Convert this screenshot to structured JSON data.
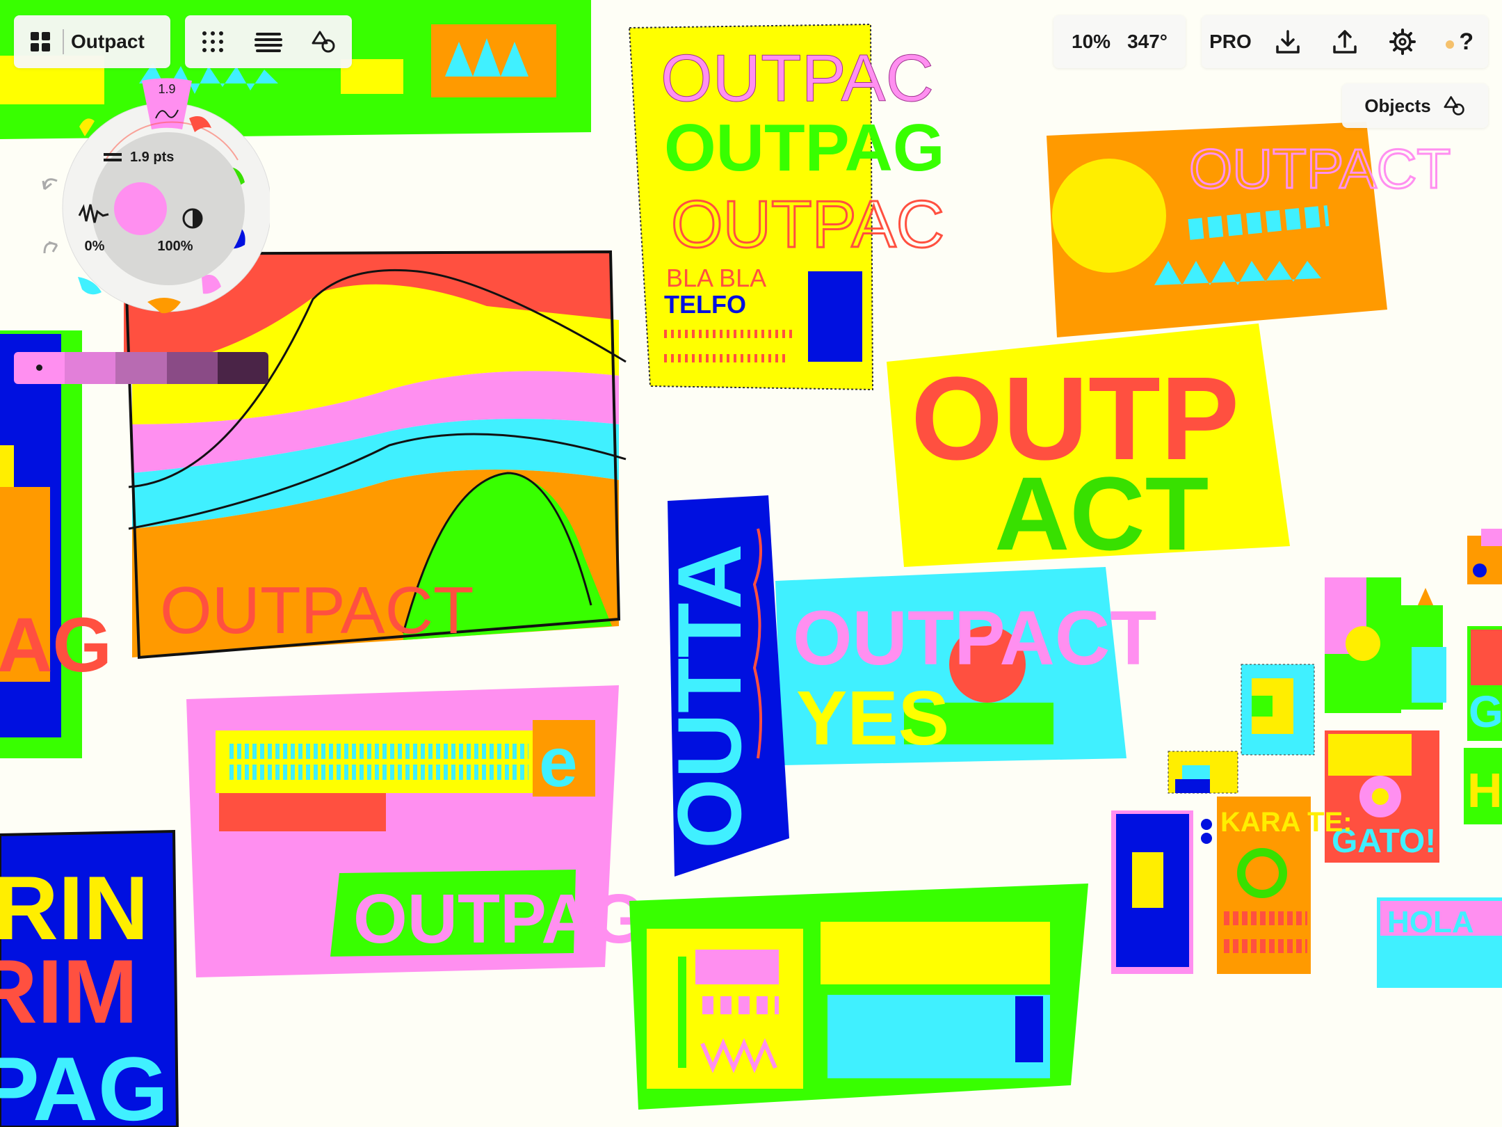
{
  "toolbar_left": {
    "gallery_icon": "grid-2x2-icon",
    "document_title": "Outpact",
    "grid_icon": "dot-grid-icon",
    "layers_icon": "layers-icon",
    "objects_icon": "shapes-icon"
  },
  "toolbar_right": {
    "zoom": "10%",
    "rotation": "347°",
    "pro_label": "PRO",
    "import_icon": "download-icon",
    "export_icon": "share-upload-icon",
    "settings_icon": "gear-icon",
    "help_label": "?",
    "status_dot_color": "#f5c16c"
  },
  "objects_panel": {
    "label": "Objects",
    "icon": "shapes-icon"
  },
  "tool_wheel": {
    "active_tool_size": "1.9",
    "stroke_weight_label": "1.9 pts",
    "smoothing_value": "0%",
    "opacity_value": "100%",
    "current_color": "#ff8ff0",
    "undo_icon": "undo-icon",
    "redo_icon": "redo-icon",
    "smoothing_icon": "squiggle-icon",
    "opacity_icon": "half-circle-icon",
    "tools": [
      {
        "name": "fineliner",
        "color": "#ff8ff0"
      },
      {
        "name": "brush-red",
        "color": "#ff5040"
      },
      {
        "name": "marker-green",
        "color": "#38e000"
      },
      {
        "name": "marker-blue",
        "color": "#0010e0"
      },
      {
        "name": "brush-pink",
        "color": "#ff8ff0"
      },
      {
        "name": "marker-orange",
        "color": "#ff9a00"
      },
      {
        "name": "marker-cyan",
        "color": "#40f0ff"
      },
      {
        "name": "marker-yellow",
        "color": "#ffee00"
      }
    ]
  },
  "palette": {
    "swatches": [
      "#ff8ff0",
      "#e27fd9",
      "#b86bb2",
      "#8a4b86",
      "#4a2447"
    ],
    "selected_index": 0
  },
  "canvas_text": {
    "outpac_1": "OUTPAC",
    "outpag_1": "OUTPAG",
    "outpac_2": "OUTPAC",
    "bla_bla": "BLA BLA",
    "telefo": "TELFO",
    "outpact_orange": "OUTPACT",
    "outpact_poster": "OUTPACT",
    "outp": "OUTP",
    "act": "ACT",
    "outpact_cyan": "OUTPACT",
    "yes": "YES",
    "outta": "OUTTA",
    "outpag_2": "OUTPAG",
    "e_letter": "e",
    "rin": "RIN",
    "rim": "RIM",
    "pag": "PAG",
    "ag": "AG",
    "karate": "KARA TE:",
    "gato": "GATO!",
    "hola": "HOLA",
    "g_letter": "G",
    "h_letter": "H"
  }
}
